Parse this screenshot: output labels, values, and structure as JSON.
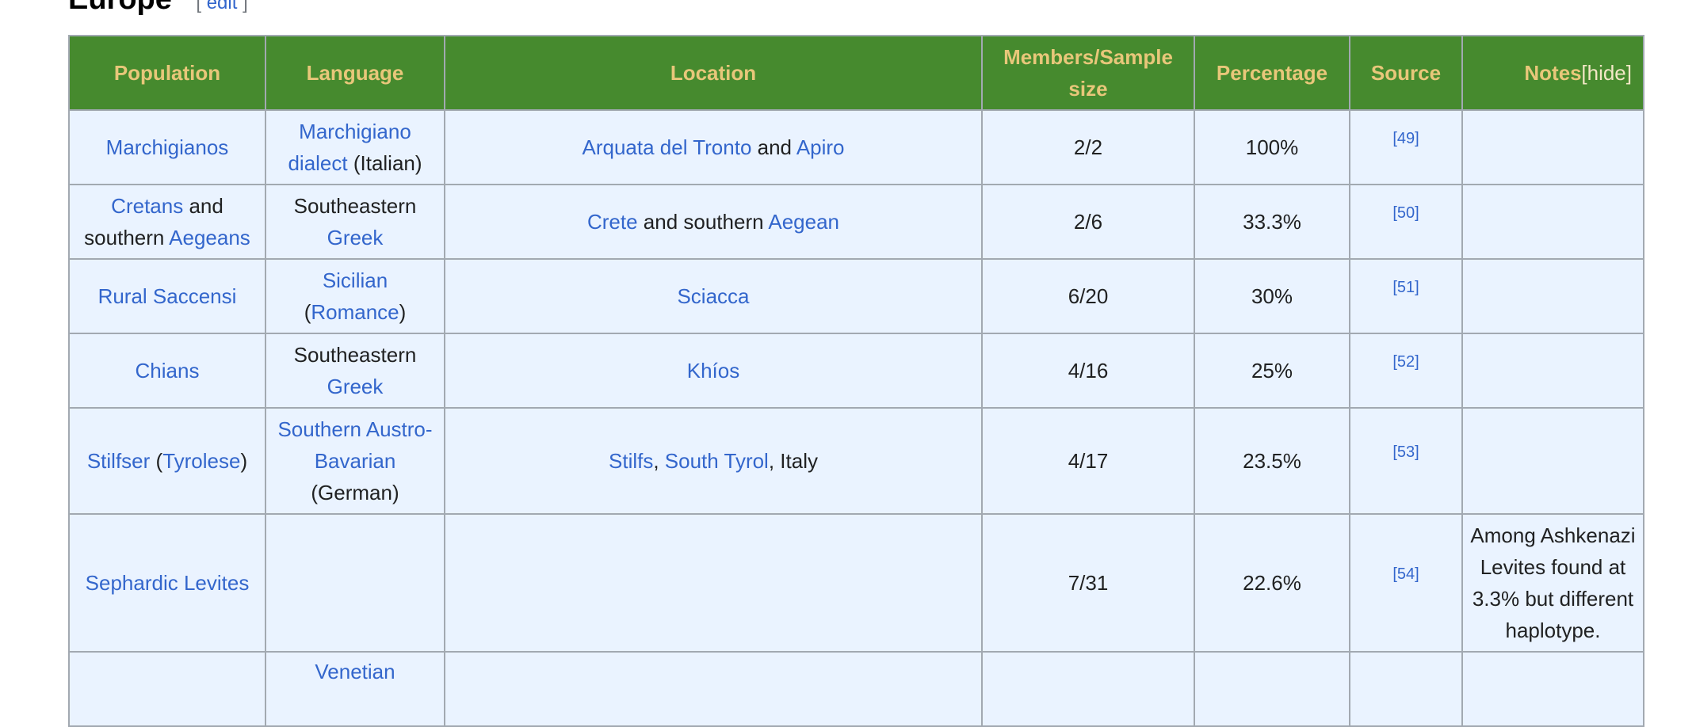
{
  "section": {
    "title": "Europe",
    "edit_open": "[",
    "edit_label": "edit",
    "edit_close": "]"
  },
  "table": {
    "headers": {
      "population": "Population",
      "language": "Language",
      "location": "Location",
      "members": "Members/Sample size",
      "percentage": "Percentage",
      "source": "Source",
      "notes": "Notes",
      "hide": "[hide]"
    },
    "rows": [
      {
        "pop_link": "Marchigianos",
        "lang_link": "Marchigiano dialect",
        "lang_rest": " (Italian)",
        "loc_link1": "Arquata del Tronto",
        "loc_mid": " and ",
        "loc_link2": "Apiro",
        "members": "2/2",
        "pct": "100%",
        "source": "[49]",
        "notes": ""
      },
      {
        "pop_link1": "Cretans",
        "pop_mid": " and southern ",
        "pop_link2": "Aegeans",
        "lang_pre": "Southeastern ",
        "lang_link": "Greek",
        "loc_link1": "Crete",
        "loc_mid": " and southern ",
        "loc_link2": "Aegean",
        "members": "2/6",
        "pct": "33.3%",
        "source": "[50]",
        "notes": ""
      },
      {
        "pop_link": "Rural Saccensi",
        "lang_link1": "Sicilian",
        "lang_open": " (",
        "lang_link2": "Romance",
        "lang_close": ")",
        "loc_link": "Sciacca",
        "members": "6/20",
        "pct": "30%",
        "source": "[51]",
        "notes": ""
      },
      {
        "pop_link": "Chians",
        "lang_pre": "Southeastern ",
        "lang_link": "Greek",
        "loc_link": "Khíos",
        "members": "4/16",
        "pct": "25%",
        "source": "[52]",
        "notes": ""
      },
      {
        "pop_link1": "Stilfser",
        "pop_open": " (",
        "pop_link2": "Tyrolese",
        "pop_close": ")",
        "lang_link": "Southern Austro-Bavarian",
        "lang_rest": " (German)",
        "loc_link1": "Stilfs",
        "loc_sep": ", ",
        "loc_link2": "South Tyrol",
        "loc_rest": ", Italy",
        "members": "4/17",
        "pct": "23.5%",
        "source": "[53]",
        "notes": ""
      },
      {
        "pop_link": "Sephardic Levites",
        "members": "7/31",
        "pct": "22.6%",
        "source": "[54]",
        "notes": "Among Ashkenazi Levites found at 3.3% but different haplotype."
      },
      {
        "lang_link": "Venetian"
      }
    ]
  }
}
